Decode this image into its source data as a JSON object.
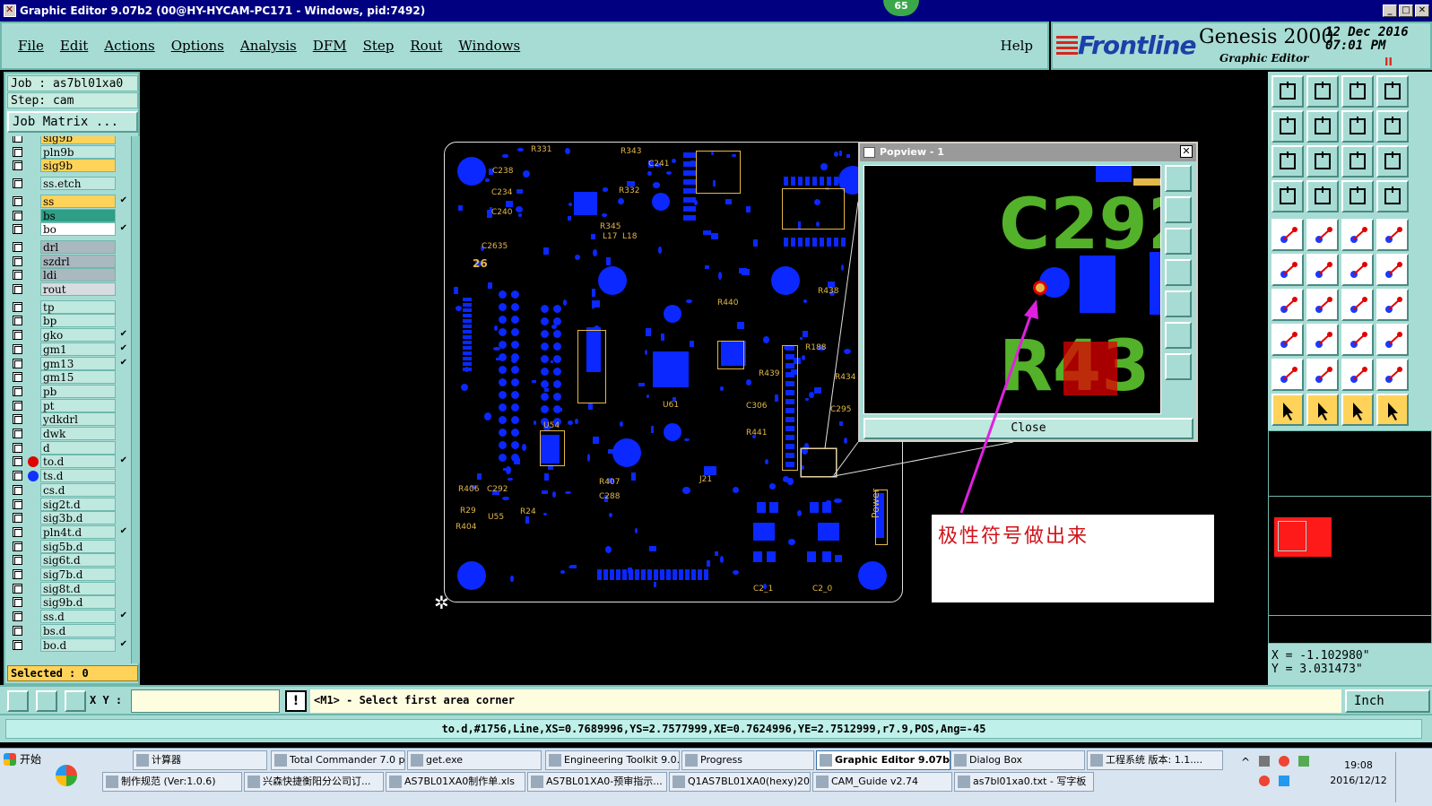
{
  "window": {
    "title": "Graphic Editor 9.07b2 (00@HY-HYCAM-PC171 - Windows, pid:7492)",
    "badge": "65",
    "controls": [
      "_",
      "□",
      "✕"
    ]
  },
  "menu": {
    "items": [
      "File",
      "Edit",
      "Actions",
      "Options",
      "Analysis",
      "DFM",
      "Step",
      "Rout",
      "Windows"
    ],
    "help": "Help"
  },
  "brand": {
    "logo": "Frontline",
    "product": "Genesis 2000",
    "subtitle": "Graphic Editor",
    "date": "12 Dec 2016",
    "time": "07:01 PM",
    "pause": "II"
  },
  "job": {
    "job_label": "Job : as7bl01xa0",
    "step_label": "Step: cam",
    "matrix_button": "Job Matrix ..."
  },
  "layers": [
    {
      "name": "sig9b",
      "bg": "#ffd35a",
      "mark": "",
      "dot": "",
      "partial": true
    },
    {
      "name": "pln9b",
      "bg": "#bfe8df",
      "mark": "",
      "dot": ""
    },
    {
      "name": "sig9b",
      "bg": "#ffd35a",
      "mark": "",
      "dot": ""
    },
    {
      "name": "ss.etch",
      "bg": "#bfe8df",
      "mark": "",
      "dot": "",
      "gap": true
    },
    {
      "name": "ss",
      "bg": "#ffd35a",
      "mark": "✔",
      "dot": "",
      "gap": true
    },
    {
      "name": "bs",
      "bg": "#2e9e86",
      "mark": "",
      "dot": ""
    },
    {
      "name": "bo",
      "bg": "#ffffff",
      "mark": "✔",
      "dot": ""
    },
    {
      "name": "drl",
      "bg": "#aab8bf",
      "mark": "",
      "dot": "",
      "gap": true
    },
    {
      "name": "szdrl",
      "bg": "#aab8bf",
      "mark": "",
      "dot": ""
    },
    {
      "name": "ldi",
      "bg": "#aab8bf",
      "mark": "",
      "dot": ""
    },
    {
      "name": "rout",
      "bg": "#d6dcdf",
      "mark": "",
      "dot": ""
    },
    {
      "name": "tp",
      "bg": "#bfe8df",
      "mark": "",
      "dot": "",
      "gap": true
    },
    {
      "name": "bp",
      "bg": "#bfe8df",
      "mark": "",
      "dot": ""
    },
    {
      "name": "gko",
      "bg": "#bfe8df",
      "mark": "✔",
      "dot": ""
    },
    {
      "name": "gm1",
      "bg": "#bfe8df",
      "mark": "✔",
      "dot": ""
    },
    {
      "name": "gm13",
      "bg": "#bfe8df",
      "mark": "✔",
      "dot": ""
    },
    {
      "name": "gm15",
      "bg": "#bfe8df",
      "mark": "",
      "dot": ""
    },
    {
      "name": "pb",
      "bg": "#bfe8df",
      "mark": "",
      "dot": ""
    },
    {
      "name": "pt",
      "bg": "#bfe8df",
      "mark": "",
      "dot": ""
    },
    {
      "name": "ydkdrl",
      "bg": "#bfe8df",
      "mark": "",
      "dot": ""
    },
    {
      "name": "dwk",
      "bg": "#bfe8df",
      "mark": "",
      "dot": ""
    },
    {
      "name": "d",
      "bg": "#bfe8df",
      "mark": "",
      "dot": ""
    },
    {
      "name": "to.d",
      "bg": "#bfe8df",
      "mark": "✔",
      "dot": "#e00000"
    },
    {
      "name": "ts.d",
      "bg": "#bfe8df",
      "mark": "",
      "dot": "#1030ff"
    },
    {
      "name": "cs.d",
      "bg": "#bfe8df",
      "mark": "",
      "dot": ""
    },
    {
      "name": "sig2t.d",
      "bg": "#bfe8df",
      "mark": "",
      "dot": ""
    },
    {
      "name": "sig3b.d",
      "bg": "#bfe8df",
      "mark": "",
      "dot": ""
    },
    {
      "name": "pln4t.d",
      "bg": "#bfe8df",
      "mark": "✔",
      "dot": ""
    },
    {
      "name": "sig5b.d",
      "bg": "#bfe8df",
      "mark": "",
      "dot": ""
    },
    {
      "name": "sig6t.d",
      "bg": "#bfe8df",
      "mark": "",
      "dot": ""
    },
    {
      "name": "sig7b.d",
      "bg": "#bfe8df",
      "mark": "",
      "dot": ""
    },
    {
      "name": "sig8t.d",
      "bg": "#bfe8df",
      "mark": "",
      "dot": ""
    },
    {
      "name": "sig9b.d",
      "bg": "#bfe8df",
      "mark": "",
      "dot": ""
    },
    {
      "name": "ss.d",
      "bg": "#bfe8df",
      "mark": "✔",
      "dot": ""
    },
    {
      "name": "bs.d",
      "bg": "#bfe8df",
      "mark": "",
      "dot": ""
    },
    {
      "name": "bo.d",
      "bg": "#bfe8df",
      "mark": "✔",
      "dot": ""
    }
  ],
  "selected": "Selected : 0",
  "board_labels": [
    "C238",
    "C234",
    "C240",
    "C2635",
    "26",
    "R331",
    "R332",
    "R343",
    "C241",
    "R345",
    "L17",
    "L18",
    "U61",
    "U54",
    "R407",
    "C288",
    "R406",
    "C292",
    "R404",
    "R29",
    "R24",
    "Power",
    "C2_1",
    "C2_0",
    "R438",
    "R188",
    "R434",
    "C295",
    "C306",
    "R441",
    "R439",
    "R440",
    "J21",
    "U55"
  ],
  "popview": {
    "title": "Popview - 1",
    "close_label": "Close",
    "zoom_text_1": "C292",
    "zoom_text_2": "R43"
  },
  "annotation": {
    "text": "极性符号做出来",
    "color": "#d0141b",
    "arrow_color": "#e020e0"
  },
  "coords": {
    "x": "X = -1.102980\"",
    "y": "Y = 3.031473\""
  },
  "command": {
    "xy_label": "X Y :",
    "xy_value": "",
    "prompt": "<M1> - Select first area corner",
    "units": "Inch"
  },
  "status": "to.d,#1756,Line,XS=0.7689996,YS=2.7577999,XE=0.7624996,YE=2.7512999,r7.9,POS,Ang=-45",
  "taskbar": {
    "start": "开始",
    "row1": [
      "计算器",
      "Total Commander 7.0 p...",
      "get.exe",
      "Engineering Toolkit 9.0...",
      "Progress",
      "Graphic Editor 9.07b...",
      "Dialog Box",
      "工程系统 版本: 1.1...."
    ],
    "row2": [
      "制作规范 (Ver:1.0.6)",
      "兴森快捷衡阳分公司订...",
      "AS7BL01XA0制作单.xls",
      "AS7BL01XA0-预审指示...",
      "Q1AS7BL01XA0(hexy)20...",
      "CAM_Guide v2.74",
      "as7bl01xa0.txt - 写字板"
    ],
    "time": "19:08",
    "date": "2016/12/12"
  }
}
